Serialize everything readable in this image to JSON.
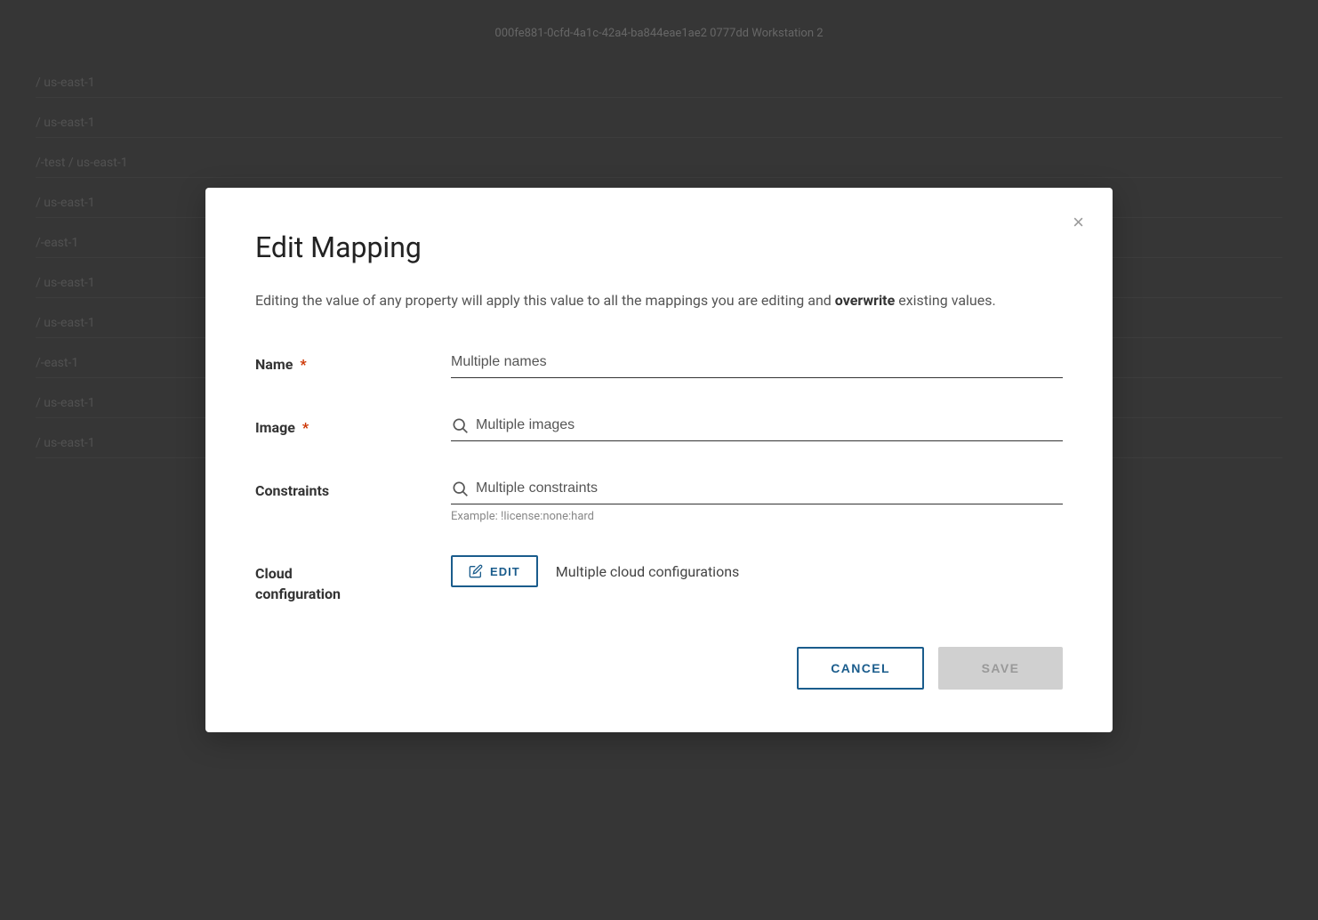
{
  "background": {
    "header_text": "000fe881-0cfd-4a1c-42a4-ba844eae1ae2 0777dd Workstation 2",
    "rows": [
      "/ us-east-1",
      "/ us-east-1",
      "/-test / us-east-1",
      "/ us-east-1",
      "/-east-1",
      "/ us-east-1",
      "/ us-east-1",
      "/-east-1",
      "/ us-east-1",
      "/ us-east-1"
    ]
  },
  "modal": {
    "title": "Edit Mapping",
    "close_label": "×",
    "description_part1": "Editing the value of any property will apply this value to all the mappings you are editing and ",
    "description_bold": "overwrite",
    "description_part2": " existing values.",
    "fields": {
      "name": {
        "label": "Name",
        "required": true,
        "placeholder": "Multiple names",
        "value": "Multiple names"
      },
      "image": {
        "label": "Image",
        "required": true,
        "placeholder": "Multiple images",
        "value": "Multiple images"
      },
      "constraints": {
        "label": "Constraints",
        "required": false,
        "placeholder": "Multiple constraints",
        "value": "Multiple constraints",
        "hint": "Example: !license:none:hard"
      },
      "cloud_configuration": {
        "label_line1": "Cloud",
        "label_line2": "configuration",
        "edit_button_label": "EDIT",
        "value": "Multiple cloud configurations"
      }
    },
    "footer": {
      "cancel_label": "CANCEL",
      "save_label": "SAVE"
    }
  },
  "icons": {
    "close": "×",
    "search": "search-icon",
    "edit": "edit-icon"
  }
}
